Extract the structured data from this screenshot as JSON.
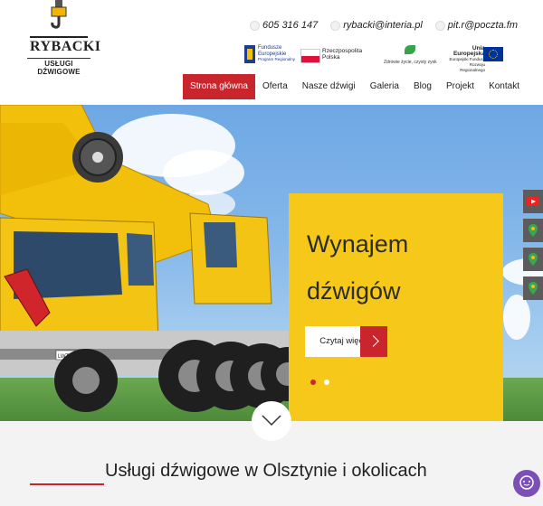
{
  "logo": {
    "brand": "RYBACKI",
    "sub": "USŁUGI DŹWIGOWE"
  },
  "contacts": [
    {
      "text": "605 316 147",
      "icon": "phone-icon"
    },
    {
      "text": "rybacki@interia.pl",
      "icon": "mail-icon"
    },
    {
      "text": "pit.r@poczta.fm",
      "icon": "mail-icon"
    }
  ],
  "eu_logos": {
    "fundusze_1": "Fundusze",
    "fundusze_2": "Europejskie",
    "fundusze_3": "Program Regionalny",
    "pl_1": "Rzeczpospolita",
    "pl_2": "Polska",
    "health": "Zdrowie życie, czysty zysk",
    "ue_1": "Unia Europejska",
    "ue_2": "Europejski Fundusz",
    "ue_3": "Rozwoju Regionalnego"
  },
  "nav": [
    "Strona główna",
    "Oferta",
    "Nasze dźwigi",
    "Galeria",
    "Blog",
    "Projekt",
    "Kontakt"
  ],
  "nav_active": 0,
  "hero": {
    "title_1": "Wynajem",
    "title_2": "dźwigów",
    "button": "Czytaj więcej",
    "plate": "LWT 1100-42"
  },
  "slider": {
    "count": 2,
    "active": 0
  },
  "section": {
    "heading": "Usługi dźwigowe w Olsztynie i okolicach"
  },
  "side_icons": [
    "youtube-icon",
    "map-pin-icon",
    "map-pin-icon",
    "map-pin-icon"
  ],
  "colors": {
    "accent": "#c8262c",
    "card": "#f6c81a",
    "chat": "#7b4fb5"
  }
}
